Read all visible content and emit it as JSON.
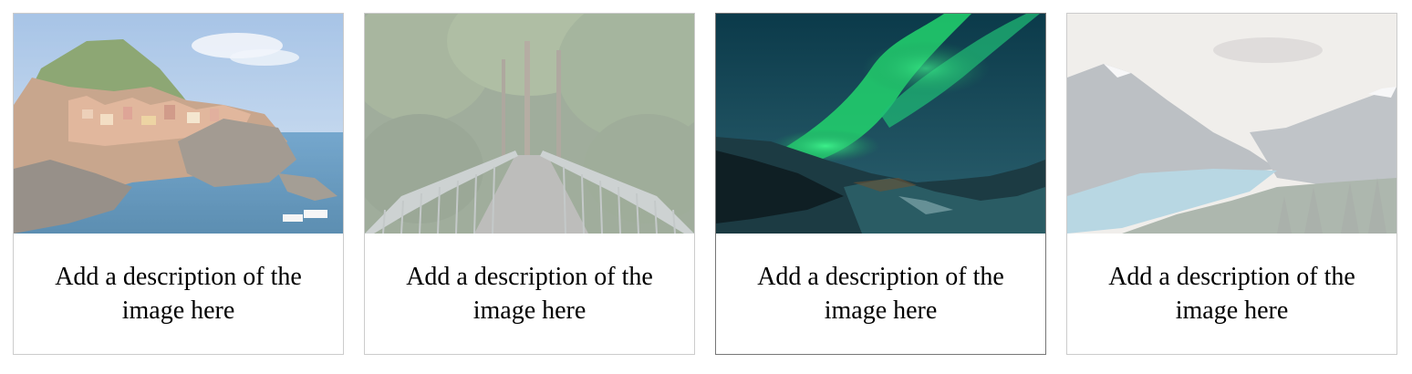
{
  "gallery": {
    "items": [
      {
        "description": "Add a description of the image here",
        "image": "cinque-terre-coastal-village",
        "hovered": false
      },
      {
        "description": "Add a description of the image here",
        "image": "forest-bridge",
        "hovered": false
      },
      {
        "description": "Add a description of the image here",
        "image": "northern-lights",
        "hovered": true
      },
      {
        "description": "Add a description of the image here",
        "image": "mountain-lake",
        "hovered": false
      }
    ]
  },
  "colors": {
    "border": "#cccccc",
    "border_hover": "#777777",
    "text": "#000000"
  }
}
